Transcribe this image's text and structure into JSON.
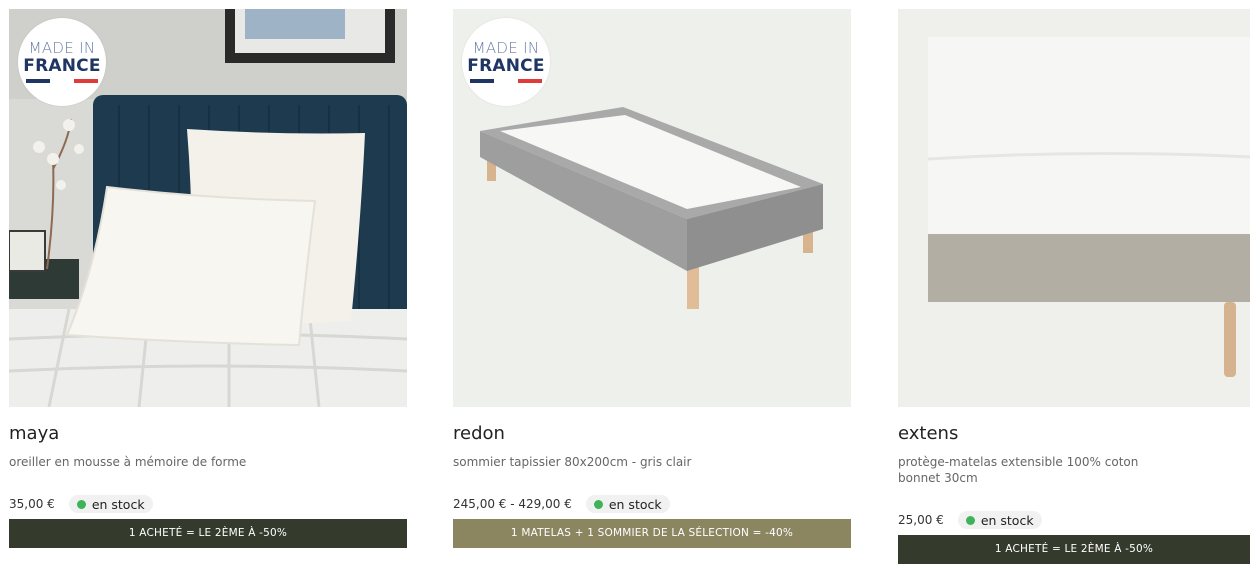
{
  "colors": {
    "stock_dot": "#3fb35a",
    "promo_dark": "#353b2c",
    "promo_olive": "#8b8560"
  },
  "products": [
    {
      "name": "maya",
      "description": "oreiller en mousse à mémoire de forme",
      "price": "35,00 €",
      "stock": "en stock",
      "promo": "1 ACHETÉ = LE 2ÈME À -50%",
      "badge": {
        "line1": "MADE IN",
        "line2": "FRANCE"
      }
    },
    {
      "name": "redon",
      "description": "sommier tapissier 80x200cm - gris clair",
      "price": "245,00 € - 429,00 €",
      "stock": "en stock",
      "promo": "1 MATELAS + 1 SOMMIER DE LA SÉLECTION = -40%",
      "badge": {
        "line1": "MADE IN",
        "line2": "FRANCE"
      }
    },
    {
      "name": "extens",
      "description": "protège-matelas extensible 100% coton bonnet 30cm",
      "price": "25,00 €",
      "stock": "en stock",
      "promo": "1 ACHETÉ = LE 2ÈME À -50%"
    }
  ]
}
